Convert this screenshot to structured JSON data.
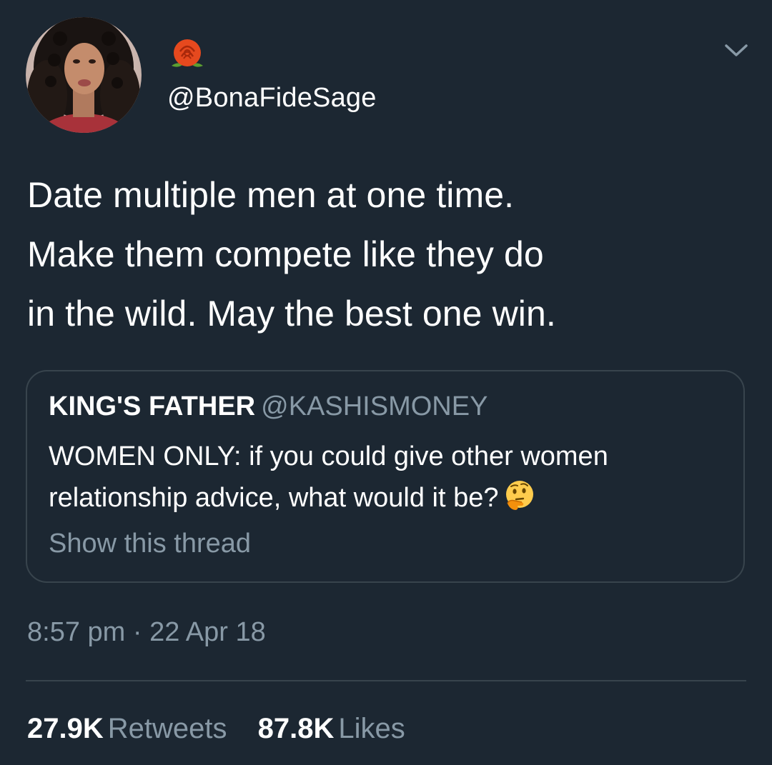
{
  "author": {
    "handle": "@BonaFideSage",
    "name_emoji": "rose-icon",
    "avatar": "avatar"
  },
  "tweet": {
    "lines": [
      "Date multiple men at one time.",
      "Make them compete like they do",
      "in the wild. May the best one win."
    ]
  },
  "quoted": {
    "name": "KING'S FATHER",
    "handle": "@KASHISMONEY",
    "lines": [
      "WOMEN ONLY: if you could give other women",
      "relationship advice, what would it be?"
    ],
    "emoji": "thinking-face-icon",
    "show_thread": "Show this thread"
  },
  "meta": {
    "timestamp": "8:57 pm · 22 Apr 18"
  },
  "stats": {
    "retweets_count": "27.9K",
    "retweets_label": "Retweets",
    "likes_count": "87.8K",
    "likes_label": "Likes"
  },
  "colors": {
    "background": "#1c2732",
    "text_primary": "#ffffff",
    "text_secondary": "#8899a6",
    "border": "#38444d"
  },
  "icons": {
    "menu": "chevron-down-icon",
    "name_emoji": "rose-icon",
    "quoted_emoji": "thinking-face-icon"
  }
}
